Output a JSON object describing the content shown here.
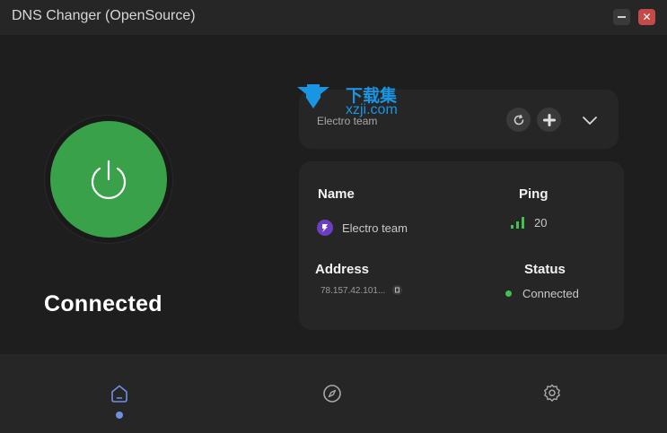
{
  "window": {
    "title": "DNS Changer (OpenSource)",
    "minimize_icon": "minimize-icon",
    "close_icon": "close-icon",
    "close_glyph": "✕"
  },
  "watermark": {
    "cn": "下载集",
    "url": "xzji.com"
  },
  "power": {
    "icon": "power-icon",
    "status": "Connected",
    "accent": "#3aa14b"
  },
  "selector": {
    "selected": "Electro team",
    "refresh_icon": "refresh-icon",
    "add_icon": "plus-icon",
    "dropdown_icon": "chevron-down-icon"
  },
  "info": {
    "name_label": "Name",
    "name_value": "Electro team",
    "ping_label": "Ping",
    "ping_value": "20",
    "address_label": "Address",
    "address_value": "78.157.42.101...",
    "status_label": "Status",
    "status_value": "Connected",
    "status_color": "#3fc24f"
  },
  "nav": {
    "items": [
      {
        "name": "home",
        "icon": "home-icon",
        "active": true
      },
      {
        "name": "explore",
        "icon": "compass-icon",
        "active": false
      },
      {
        "name": "settings",
        "icon": "gear-icon",
        "active": false
      }
    ],
    "active_color": "#6f8fe0"
  }
}
